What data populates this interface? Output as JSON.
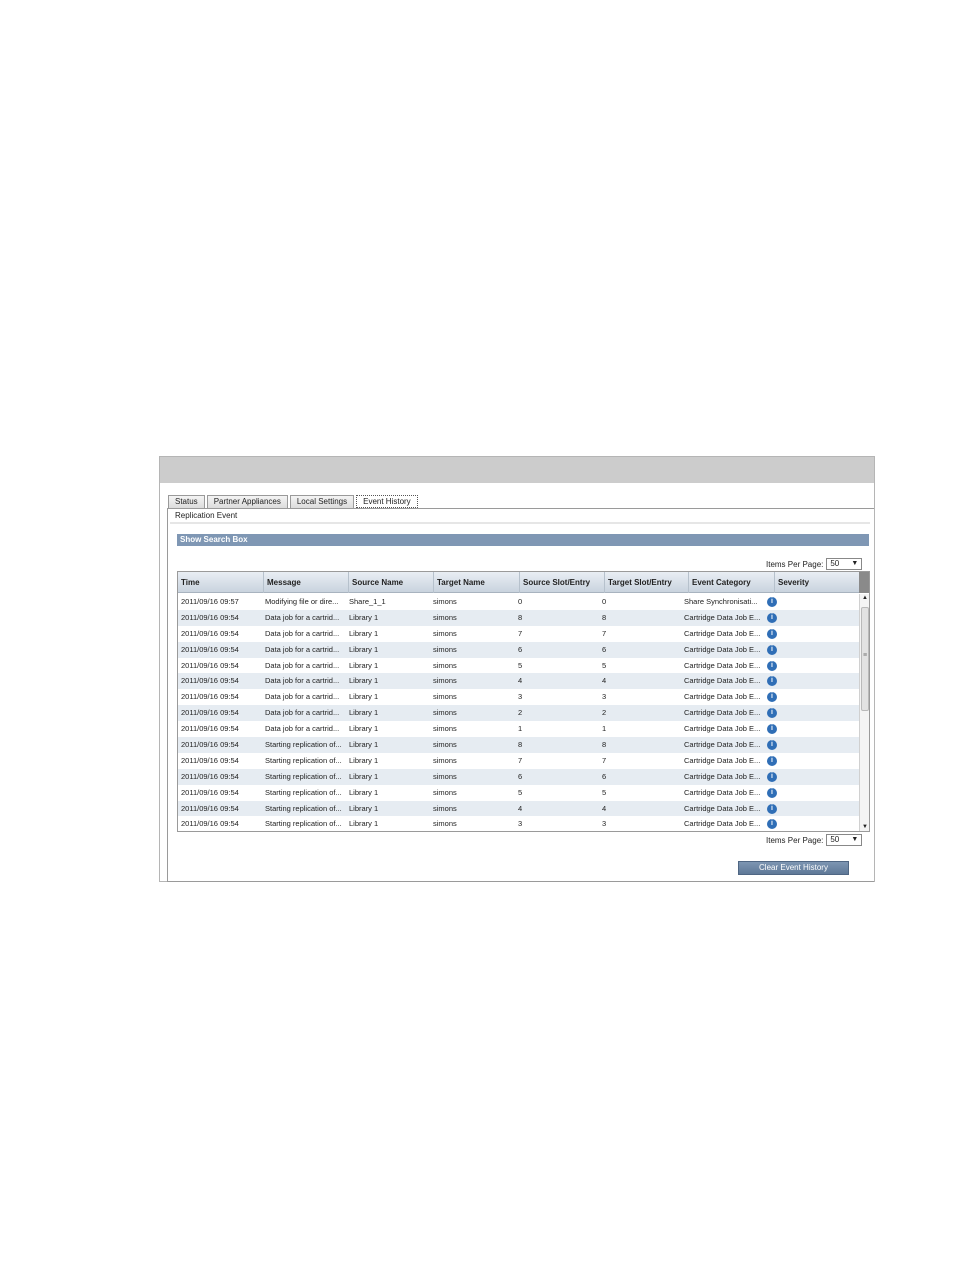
{
  "tabs": [
    {
      "label": "Status"
    },
    {
      "label": "Partner Appliances"
    },
    {
      "label": "Local Settings"
    },
    {
      "label": "Event History"
    }
  ],
  "active_tab": "Event History",
  "subtab": "Replication Event",
  "search_toggle": "Show Search Box",
  "items_per_page": {
    "label": "Items Per Page:",
    "value": "50"
  },
  "table": {
    "columns": [
      "Time",
      "Message",
      "Source Name",
      "Target Name",
      "Source Slot/Entry",
      "Target Slot/Entry",
      "Event Category",
      "Severity"
    ],
    "rows": [
      [
        "2011/09/16 09:57",
        "Modifying file or dire...",
        "Share_1_1",
        "simons",
        "0",
        "0",
        "Share Synchronisati..."
      ],
      [
        "2011/09/16 09:54",
        "Data job for a cartrid...",
        "Library 1",
        "simons",
        "8",
        "8",
        "Cartridge Data Job E..."
      ],
      [
        "2011/09/16 09:54",
        "Data job for a cartrid...",
        "Library 1",
        "simons",
        "7",
        "7",
        "Cartridge Data Job E..."
      ],
      [
        "2011/09/16 09:54",
        "Data job for a cartrid...",
        "Library 1",
        "simons",
        "6",
        "6",
        "Cartridge Data Job E..."
      ],
      [
        "2011/09/16 09:54",
        "Data job for a cartrid...",
        "Library 1",
        "simons",
        "5",
        "5",
        "Cartridge Data Job E..."
      ],
      [
        "2011/09/16 09:54",
        "Data job for a cartrid...",
        "Library 1",
        "simons",
        "4",
        "4",
        "Cartridge Data Job E..."
      ],
      [
        "2011/09/16 09:54",
        "Data job for a cartrid...",
        "Library 1",
        "simons",
        "3",
        "3",
        "Cartridge Data Job E..."
      ],
      [
        "2011/09/16 09:54",
        "Data job for a cartrid...",
        "Library 1",
        "simons",
        "2",
        "2",
        "Cartridge Data Job E..."
      ],
      [
        "2011/09/16 09:54",
        "Data job for a cartrid...",
        "Library 1",
        "simons",
        "1",
        "1",
        "Cartridge Data Job E..."
      ],
      [
        "2011/09/16 09:54",
        "Starting replication of...",
        "Library 1",
        "simons",
        "8",
        "8",
        "Cartridge Data Job E..."
      ],
      [
        "2011/09/16 09:54",
        "Starting replication of...",
        "Library 1",
        "simons",
        "7",
        "7",
        "Cartridge Data Job E..."
      ],
      [
        "2011/09/16 09:54",
        "Starting replication of...",
        "Library 1",
        "simons",
        "6",
        "6",
        "Cartridge Data Job E..."
      ],
      [
        "2011/09/16 09:54",
        "Starting replication of...",
        "Library 1",
        "simons",
        "5",
        "5",
        "Cartridge Data Job E..."
      ],
      [
        "2011/09/16 09:54",
        "Starting replication of...",
        "Library 1",
        "simons",
        "4",
        "4",
        "Cartridge Data Job E..."
      ],
      [
        "2011/09/16 09:54",
        "Starting replication of...",
        "Library 1",
        "simons",
        "3",
        "3",
        "Cartridge Data Job E..."
      ]
    ],
    "severity_icon": "info-icon",
    "severity_glyph": "i"
  },
  "clear_button": "Clear Event History",
  "colors": {
    "accent": "#7f97b4",
    "row_alt": "#e6ecf2",
    "info": "#2f6eb6"
  }
}
